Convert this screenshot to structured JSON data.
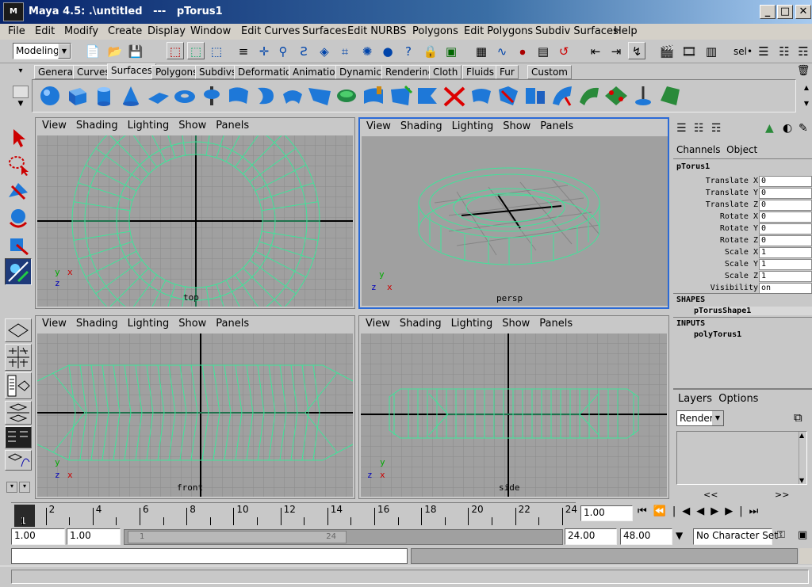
{
  "window": {
    "title": "Maya 4.5: .\\untitled   ---   pTorus1",
    "minimize": "_",
    "maximize": "□",
    "close": "✕"
  },
  "menu": [
    "File",
    "Edit",
    "Modify",
    "Create",
    "Display",
    "Window",
    "Edit Curves",
    "Surfaces",
    "Edit NURBS",
    "Polygons",
    "Edit Polygons",
    "Subdiv Surfaces",
    "Help"
  ],
  "status": {
    "mode": "Modeling",
    "sel_label": "sel•"
  },
  "shelf_tabs": [
    "General",
    "Curves",
    "Surfaces",
    "Polygons",
    "Subdivs",
    "Deformation",
    "Animation",
    "Dynamics",
    "Rendering",
    "Cloth",
    "Fluids",
    "Fur",
    "Custom"
  ],
  "shelf_active": "Surfaces",
  "viewport_menu": [
    "View",
    "Shading",
    "Lighting",
    "Show",
    "Panels"
  ],
  "viewports": {
    "top": {
      "label": "top"
    },
    "persp": {
      "label": "persp"
    },
    "front": {
      "label": "front"
    },
    "side": {
      "label": "side"
    }
  },
  "axis": {
    "x": "x",
    "y": "y",
    "z": "z"
  },
  "channels": {
    "tabs": [
      "Channels",
      "Object"
    ],
    "object": "pTorus1",
    "attrs": [
      {
        "label": "Translate X",
        "value": "0"
      },
      {
        "label": "Translate Y",
        "value": "0"
      },
      {
        "label": "Translate Z",
        "value": "0"
      },
      {
        "label": "Rotate X",
        "value": "0"
      },
      {
        "label": "Rotate Y",
        "value": "0"
      },
      {
        "label": "Rotate Z",
        "value": "0"
      },
      {
        "label": "Scale X",
        "value": "1"
      },
      {
        "label": "Scale Y",
        "value": "1"
      },
      {
        "label": "Scale Z",
        "value": "1"
      },
      {
        "label": "Visibility",
        "value": "on"
      }
    ],
    "shapes_header": "SHAPES",
    "shape": "pTorusShape1",
    "inputs_header": "INPUTS",
    "input": "polyTorus1"
  },
  "layers": {
    "tabs": [
      "Layers",
      "Options"
    ],
    "select": "Render",
    "left_arrows": "<<",
    "right_arrows": ">>"
  },
  "timeline": {
    "ticks": [
      "2",
      "4",
      "6",
      "8",
      "10",
      "12",
      "14",
      "16",
      "18",
      "20",
      "22",
      "24"
    ],
    "current": "1",
    "current_field": "1.00"
  },
  "range": {
    "start": "1.00",
    "playback_start": "1.00",
    "slider_start": "1",
    "slider_end": "24",
    "playback_end": "24.00",
    "end": "48.00",
    "charset": "No Character Set"
  },
  "colors": {
    "wire": "#3fe49a",
    "grid": "#8a8a8a",
    "axis": "#000000",
    "active_border": "#2b6ad6"
  }
}
